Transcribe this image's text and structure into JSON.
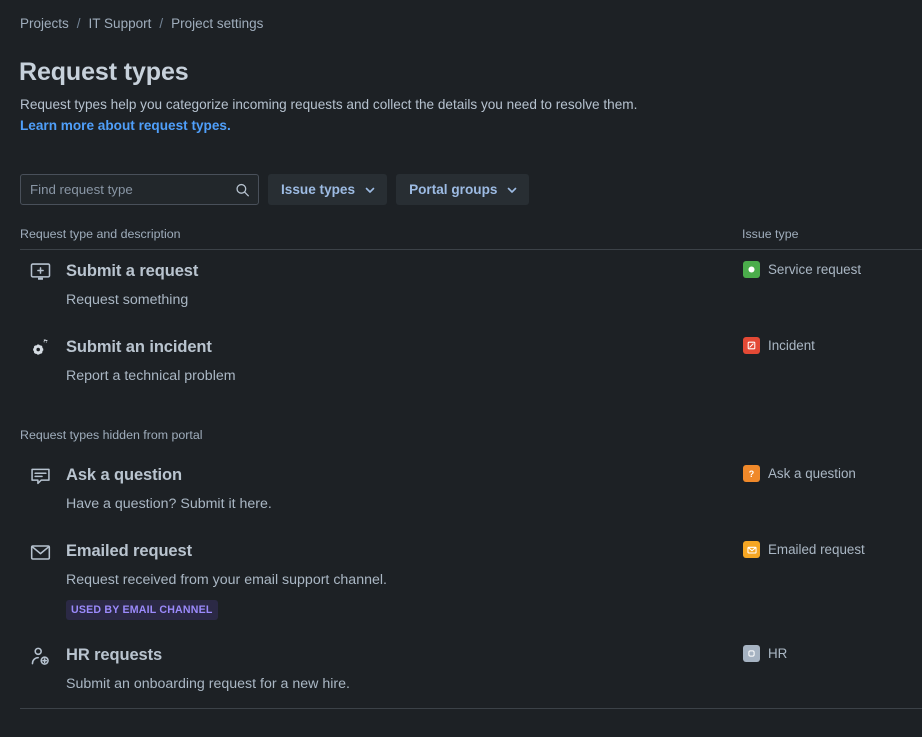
{
  "breadcrumb": {
    "items": [
      {
        "label": "Projects"
      },
      {
        "label": "IT Support"
      },
      {
        "label": "Project settings"
      }
    ],
    "separator": "/"
  },
  "header": {
    "title": "Request types"
  },
  "intro": {
    "text": "Request types help you categorize incoming requests and collect the details you need to resolve them.",
    "link_label": "Learn more about request types."
  },
  "toolbar": {
    "search": {
      "placeholder": "Find request type",
      "value": "",
      "icon": "search-icon"
    },
    "filters": [
      {
        "label": "Issue types",
        "icon": "chevron-down-icon"
      },
      {
        "label": "Portal groups",
        "icon": "chevron-down-icon"
      }
    ]
  },
  "table": {
    "columns": {
      "name": "Request type and description",
      "issue_type": "Issue type"
    },
    "sections": [
      {
        "label": "",
        "rows": [
          {
            "icon": "monitor-plus-icon",
            "name": "Submit a request",
            "description": "Request something",
            "tag": "",
            "issue_type": {
              "label": "Service request",
              "icon": "service-request-icon",
              "color": "#4bad4b"
            }
          },
          {
            "icon": "gears-icon",
            "name": "Submit an incident",
            "description": "Report a technical problem",
            "tag": "",
            "issue_type": {
              "label": "Incident",
              "icon": "incident-icon",
              "color": "#e34935"
            }
          }
        ]
      },
      {
        "label": "Request types hidden from portal",
        "rows": [
          {
            "icon": "comment-icon",
            "name": "Ask a question",
            "description": "Have a question? Submit it here.",
            "tag": "",
            "issue_type": {
              "label": "Ask a question",
              "icon": "question-mark-icon",
              "color": "#f0892a"
            }
          },
          {
            "icon": "envelope-icon",
            "name": "Emailed request",
            "description": "Request received from your email support channel.",
            "tag": "USED BY EMAIL CHANNEL",
            "issue_type": {
              "label": "Emailed request",
              "icon": "emailed-request-icon",
              "color": "#f5a623"
            }
          },
          {
            "icon": "person-plus-icon",
            "name": "HR requests",
            "description": "Submit an onboarding request for a new hire.",
            "tag": "",
            "issue_type": {
              "label": "HR",
              "icon": "hr-icon",
              "color": "#a6b3c2"
            }
          }
        ]
      }
    ]
  },
  "colors": {
    "background": "#1d2125",
    "link": "#4f9ffa",
    "tag_background": "#2b2945",
    "tag_text": "#9b8afb",
    "divider": "#3c4248"
  }
}
